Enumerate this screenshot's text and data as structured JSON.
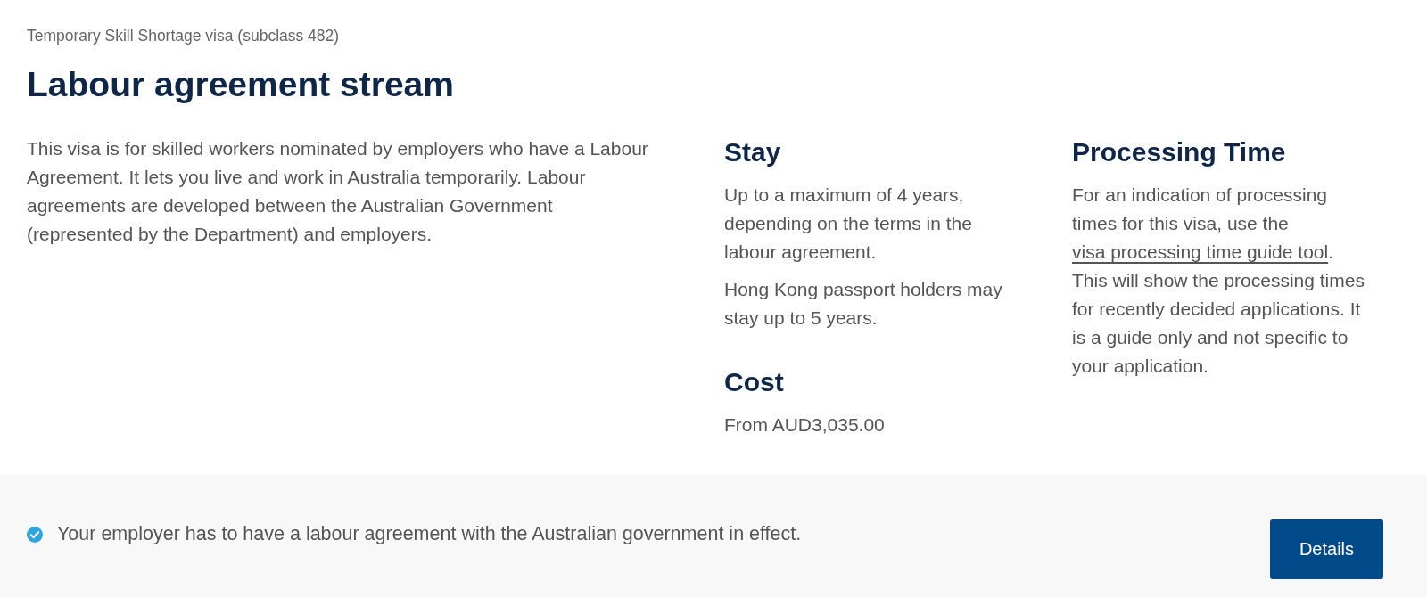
{
  "breadcrumb": "Temporary Skill Shortage visa (subclass 482)",
  "title": "Labour agreement stream",
  "description": "This visa is for skilled workers nominated by employers who have a Labour Agreement. It lets you live and work in Australia temporarily. Labour agreements are developed between the Australian Government (represented by the Department) and employers.",
  "stay": {
    "heading": "Stay",
    "paragraphs": [
      "Up to a maximum of 4 years, depending on the terms in the labour agreement.",
      "Hong Kong passport holders may stay up to 5 years."
    ]
  },
  "cost": {
    "heading": "Cost",
    "text": "From AUD3,035.00"
  },
  "processing_time": {
    "heading": "Processing Time",
    "text_before": "For an indication of processing times for this visa, use the",
    "link": "visa processing time guide tool",
    "text_after": ". This will show the processing times for recently decided applications. It is a guide only and not specific to your application."
  },
  "requirement": {
    "text": "Your employer has to have a labour agreement with the Australian government in effect.",
    "button": "Details"
  }
}
